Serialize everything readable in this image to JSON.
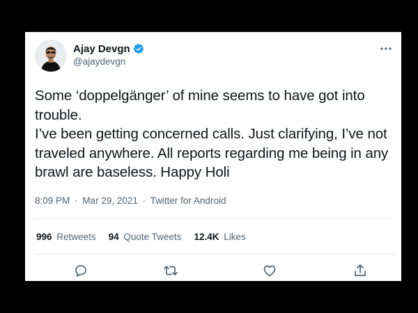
{
  "tweet": {
    "author": {
      "name": "Ajay Devgn",
      "handle": "@ajaydevgn",
      "verified": true
    },
    "text": "Some ‘doppelgänger’ of mine seems to have got into trouble.\nI’ve been getting concerned calls. Just clarifying, I’ve not traveled anywhere. All reports regarding me being in any brawl are baseless. Happy Holi",
    "time": "8:09 PM",
    "separator": "·",
    "date": "Mar 29, 2021",
    "source": "Twitter for Android",
    "stats": {
      "retweets_count": "996",
      "retweets_label": "Retweets",
      "quote_count": "94",
      "quote_label": "Quote Tweets",
      "likes_count": "12.4K",
      "likes_label": "Likes"
    }
  },
  "icons": {
    "more": "more-horizontal-icon",
    "reply": "reply-icon",
    "retweet": "retweet-icon",
    "like": "like-icon",
    "share": "share-icon",
    "verified": "verified-badge-icon"
  },
  "colors": {
    "verified_blue": "#1d9bf0",
    "text_primary": "#0f1419",
    "text_secondary": "#536471",
    "icon_gray": "#536471",
    "background_outer": "#000000",
    "card": "#ffffff"
  }
}
